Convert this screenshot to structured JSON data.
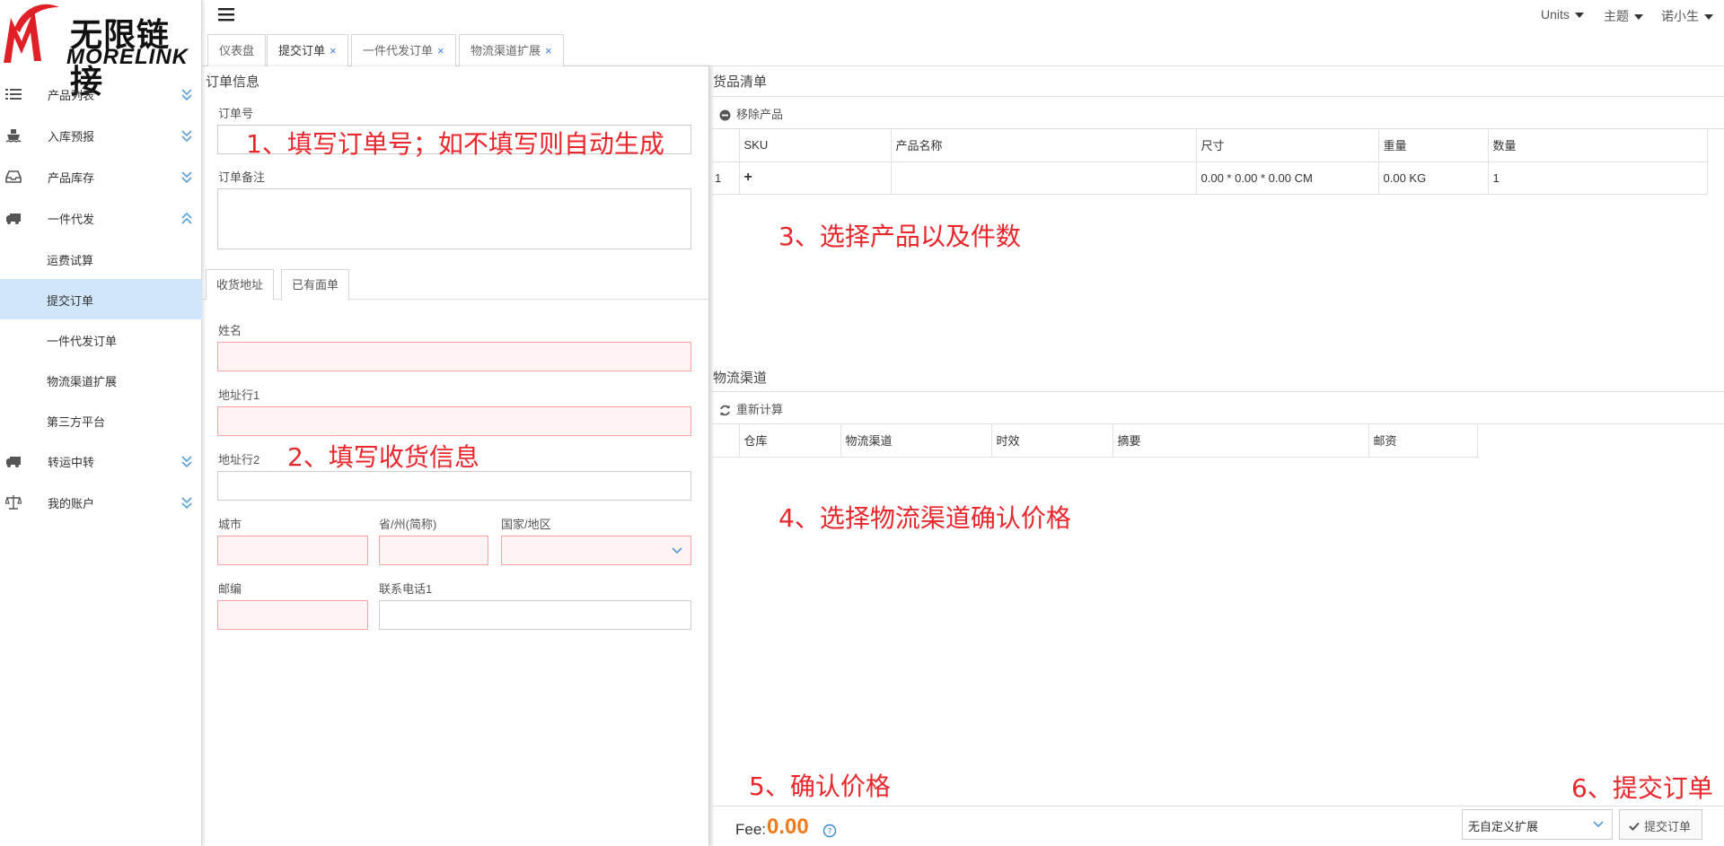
{
  "brand": {
    "name_cn": "无限链接",
    "name_en": "MORELINK"
  },
  "sidebar": {
    "items": [
      {
        "label": "产品列表",
        "icon": "list-icon",
        "expanded": false
      },
      {
        "label": "入库预报",
        "icon": "ship-icon",
        "expanded": false
      },
      {
        "label": "产品库存",
        "icon": "inbox-icon",
        "expanded": false
      },
      {
        "label": "一件代发",
        "icon": "truck-icon",
        "expanded": true
      },
      {
        "label": "转运中转",
        "icon": "truck-icon",
        "expanded": false
      },
      {
        "label": "我的账户",
        "icon": "balance-scale-icon",
        "expanded": false
      }
    ],
    "subitems": [
      "运费试算",
      "提交订单",
      "一件代发订单",
      "物流渠道扩展",
      "第三方平台"
    ],
    "active_subitem": "提交订单"
  },
  "topbar": {
    "units": "Units",
    "theme": "主题",
    "user": "诺小生"
  },
  "tabs": [
    {
      "label": "仪表盘",
      "closable": false
    },
    {
      "label": "提交订单",
      "closable": true
    },
    {
      "label": "一件代发订单",
      "closable": true
    },
    {
      "label": "物流渠道扩展",
      "closable": true
    }
  ],
  "order_panel": {
    "title": "订单信息",
    "order_no_label": "订单号",
    "order_note_label": "订单备注",
    "address_tabs": [
      "收货地址",
      "已有面单"
    ],
    "name_label": "姓名",
    "address1_label": "地址行1",
    "address2_label": "地址行2",
    "city_label": "城市",
    "state_label": "省/州(简称)",
    "country_label": "国家/地区",
    "zip_label": "邮编",
    "phone_label": "联系电话1"
  },
  "goods": {
    "title": "货品清单",
    "remove_label": "移除产品",
    "headers": [
      "SKU",
      "产品名称",
      "尺寸",
      "重量",
      "数量"
    ],
    "rows": [
      {
        "index": "1",
        "sku": "+",
        "name": "",
        "size": "0.00 * 0.00 * 0.00 CM",
        "weight": "0.00 KG",
        "qty": "1"
      }
    ]
  },
  "logistics": {
    "title": "物流渠道",
    "recalc_label": "重新计算",
    "headers": [
      "仓库",
      "物流渠道",
      "时效",
      "摘要",
      "邮资"
    ]
  },
  "annotations": {
    "step1": "1、填写订单号；如不填写则自动生成",
    "step2": "2、填写收货信息",
    "step3": "3、选择产品以及件数",
    "step4": "4、选择物流渠道确认价格",
    "step5": "5、确认价格",
    "step6": "6、提交订单"
  },
  "footer": {
    "fee_label": "Fee:",
    "fee_value": "0.00",
    "extension_select": "无自定义扩展",
    "submit_label": "提交订单"
  },
  "colors": {
    "annotation": "#e8262b",
    "fee": "#f07a1a",
    "active_menu": "#cfe6fb",
    "required_field": "#fff3f3"
  }
}
